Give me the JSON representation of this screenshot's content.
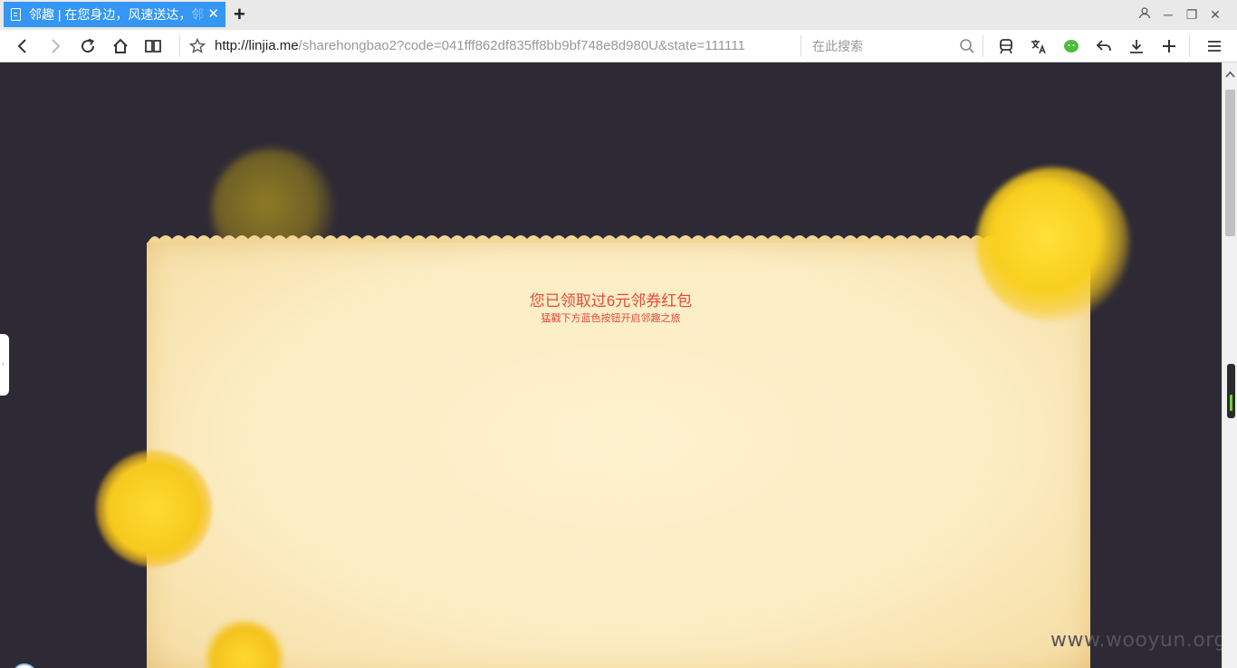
{
  "tab": {
    "title": "邻趣 | 在您身边，风速送达，邻",
    "close": "✕",
    "new_tab": "+"
  },
  "window": {
    "minimize": "─",
    "restore": "❐",
    "close": "✕"
  },
  "address": {
    "host": "http://linjia.me",
    "path": "/sharehongbao2?code=041fff862df835ff8bb9bf748e8d980U&state=111111"
  },
  "search": {
    "placeholder": "在此搜索"
  },
  "page": {
    "message": "您已领取过6元邻券红包",
    "hint": "猛戳下方蓝色按钮开启邻趣之旅"
  },
  "watermark": "www.wooyun.org",
  "colors": {
    "tab_active": "#3596f4",
    "background": "#2e2a35",
    "paper": "#fcedc4",
    "message_text": "#e8493b",
    "coin": "#f8cf1e"
  },
  "icons": [
    "page-icon",
    "back-icon",
    "forward-icon",
    "reload-icon",
    "home-icon",
    "reading-mode-icon",
    "star-icon",
    "search-icon",
    "train-icon",
    "translate-icon",
    "wechat-icon",
    "undo-icon",
    "download-icon",
    "plus-icon",
    "menu-icon",
    "user-icon"
  ]
}
